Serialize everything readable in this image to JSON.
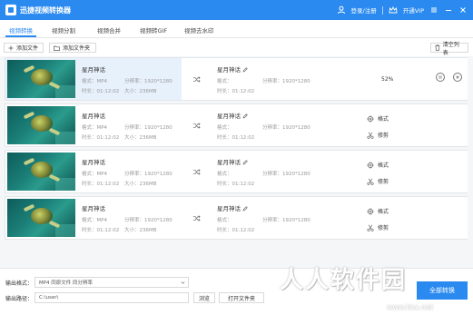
{
  "window": {
    "title": "迅捷视频转换器",
    "login_label": "登录/注册",
    "vip_label": "开通VIP"
  },
  "tabs": [
    {
      "label": "视频转换",
      "active": true
    },
    {
      "label": "视频分割",
      "active": false
    },
    {
      "label": "视频合并",
      "active": false
    },
    {
      "label": "视频转GIF",
      "active": false
    },
    {
      "label": "视频去水印",
      "active": false
    }
  ],
  "toolbar": {
    "add_file": "添加文件",
    "add_folder": "添加文件夹",
    "clear_list": "清空列表"
  },
  "files": [
    {
      "name": "星月神话",
      "source": {
        "format_label": "格式：MP4",
        "resolution_label": "分辨率：1920*1280",
        "duration_label": "时长：01:12:02",
        "size_label": "大小：236MB"
      },
      "output": {
        "name": "星月神话",
        "resolution_label": "分辨率：1920*1280",
        "format_label": "格式：",
        "duration_label": "时长：01:12:02"
      },
      "progress": "52%",
      "selected": true
    },
    {
      "name": "星月神话",
      "source": {
        "format_label": "格式：MP4",
        "resolution_label": "分辨率：1920*1280",
        "duration_label": "时长：01:12:02",
        "size_label": "大小：236MB"
      },
      "output": {
        "name": "星月神话",
        "resolution_label": "分辨率：1920*1280",
        "format_label": "格式：",
        "duration_label": "时长：01:12:02"
      },
      "format_action": "格式",
      "edit_action": "修剪"
    },
    {
      "name": "星月神话",
      "source": {
        "format_label": "格式：MP4",
        "resolution_label": "分辨率：1920*1280",
        "duration_label": "时长：01:12:02",
        "size_label": "大小：236MB"
      },
      "output": {
        "name": "星月神话",
        "resolution_label": "分辨率：1920*1280",
        "format_label": "格式：",
        "duration_label": "时长：01:12:02"
      },
      "format_action": "格式",
      "edit_action": "修剪"
    },
    {
      "name": "星月神话",
      "source": {
        "format_label": "格式：MP4",
        "resolution_label": "分辨率：1920*1280",
        "duration_label": "时长：01:12:02",
        "size_label": "大小：236MB"
      },
      "output": {
        "name": "星月神话",
        "resolution_label": "分辨率：1920*1280",
        "format_label": "格式：",
        "duration_label": "时长：01:12:02"
      },
      "format_action": "格式",
      "edit_action": "修剪"
    }
  ],
  "bottom": {
    "output_format_label": "输出格式：",
    "output_format_value": "MP4 同原文件 同分辨率",
    "output_path_label": "输出路径：",
    "output_path_value": "C:\\user\\",
    "browse_label": "浏览",
    "open_folder_label": "打开文件夹",
    "convert_label": "全部转换"
  },
  "watermark": {
    "text": "人人软件园",
    "url": "www.kkx.net"
  },
  "colors": {
    "accent": "#2a8af0",
    "selected_row": "#e7f1fc",
    "list_background": "#f4f6f8"
  }
}
